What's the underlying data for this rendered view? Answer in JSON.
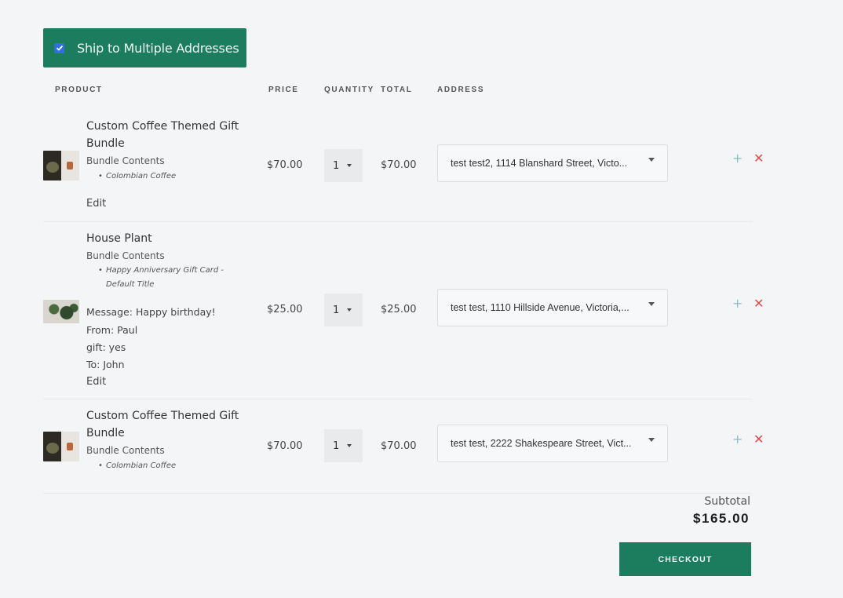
{
  "ship_multiple": {
    "label": "Ship to Multiple Addresses",
    "checked": true
  },
  "columns": {
    "product": "PRODUCT",
    "price": "PRICE",
    "quantity": "QUANTITY",
    "total": "TOTAL",
    "address": "ADDRESS"
  },
  "items": [
    {
      "name_line1": "Custom Coffee Themed Gift",
      "name_line2": "Bundle",
      "bundle_label": "Bundle Contents",
      "bundle_items": [
        "Colombian Coffee"
      ],
      "price": "$70.00",
      "quantity": "1",
      "total": "$70.00",
      "address": "test test2, 1114 Blanshard Street, Victo...",
      "edit_label": "Edit",
      "thumbnail_icon": "coffee-bundle-image"
    },
    {
      "name_line1": "House Plant",
      "bundle_label": "Bundle Contents",
      "bundle_items": [
        "Happy Anniversary Gift Card -",
        "Default Title"
      ],
      "message": "Message: Happy birthday!",
      "from": "From: Paul",
      "gift": "gift: yes",
      "to": "To: John",
      "price": "$25.00",
      "quantity": "1",
      "total": "$25.00",
      "address": "test test, 1110 Hillside Avenue, Victoria,...",
      "edit_label": "Edit",
      "thumbnail_icon": "house-plant-image"
    },
    {
      "name_line1": "Custom Coffee Themed Gift",
      "name_line2": "Bundle",
      "bundle_label": "Bundle Contents",
      "bundle_items": [
        "Colombian Coffee"
      ],
      "price": "$70.00",
      "quantity": "1",
      "total": "$70.00",
      "address": "test test, 2222 Shakespeare Street, Vict...",
      "thumbnail_icon": "coffee-bundle-image"
    }
  ],
  "row_actions": {
    "add_symbol": "+",
    "remove_symbol": "✕"
  },
  "summary": {
    "subtotal_label": "Subtotal",
    "subtotal_value": "$165.00"
  },
  "checkout_label": "CHECKOUT",
  "colors": {
    "brand_green": "#1b7d5e",
    "remove_red": "#e24b4b",
    "add_blue": "#8cc0cc"
  }
}
